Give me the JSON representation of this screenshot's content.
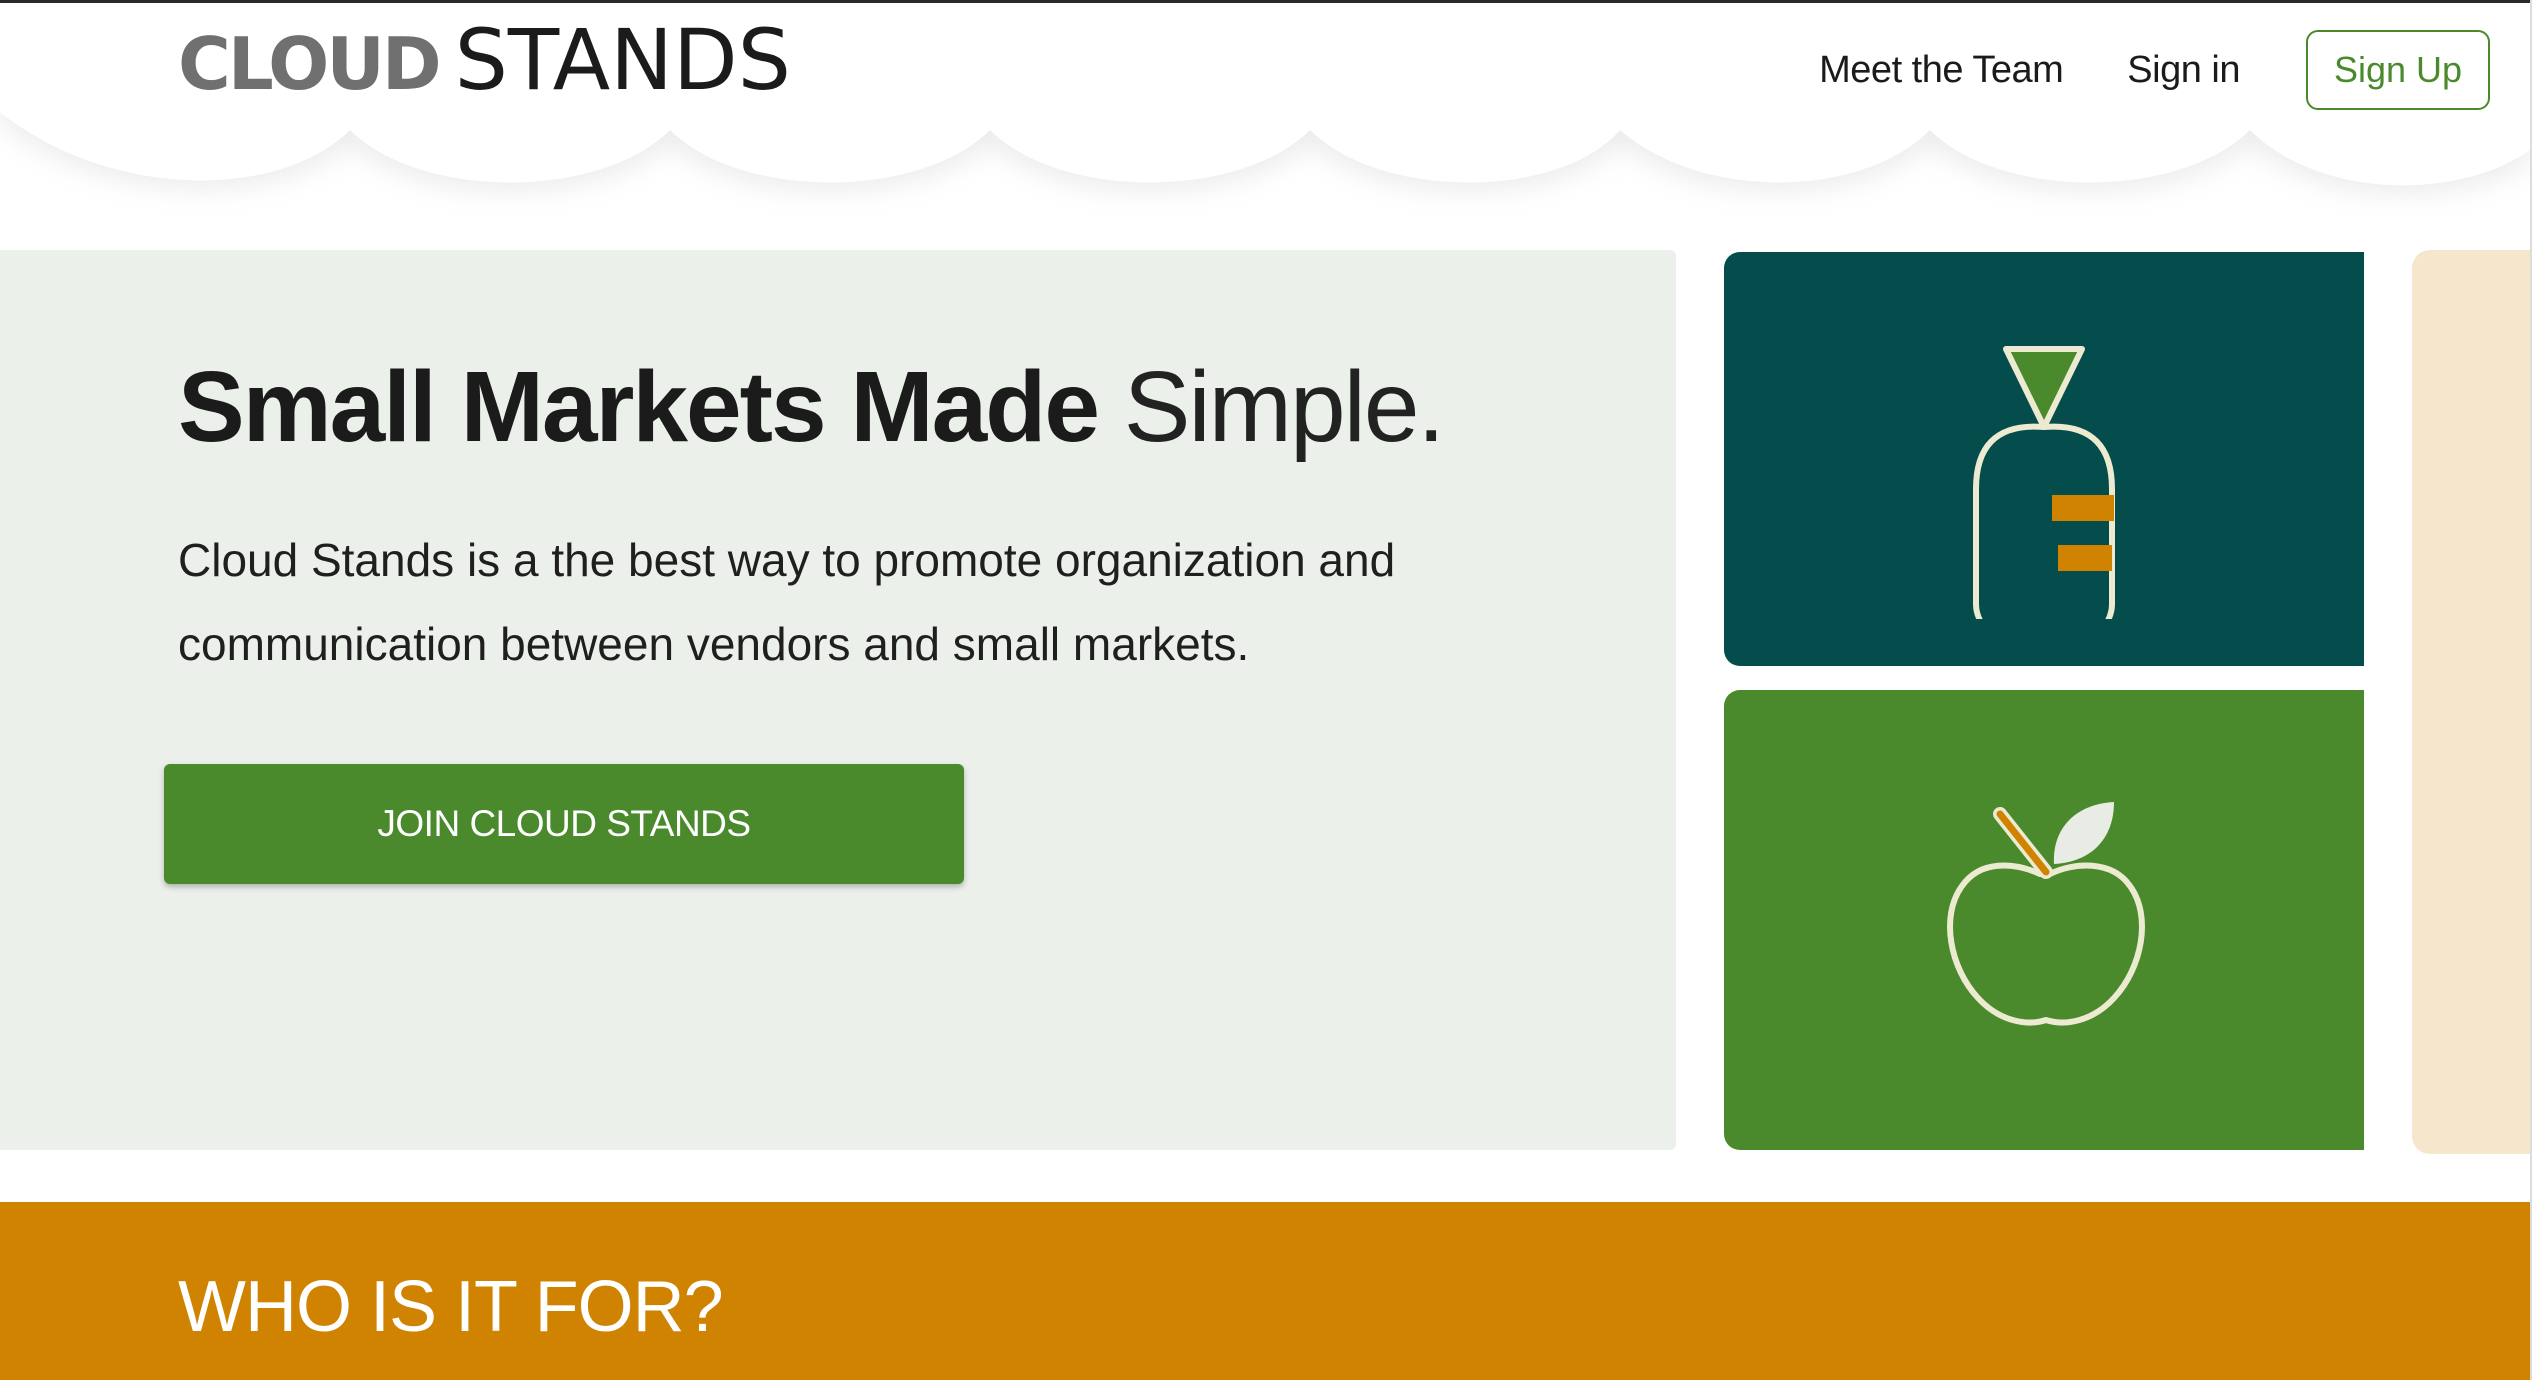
{
  "header": {
    "logo_bold": "CLOUD",
    "logo_thin": "STANDS",
    "nav": {
      "meet_team": "Meet the Team",
      "sign_in": "Sign in",
      "sign_up": "Sign Up"
    }
  },
  "hero": {
    "title_bold": "Small Markets Made",
    "title_light": "Simple.",
    "description": "Cloud Stands is a the best way to promote organization and communication between vendors and small markets.",
    "cta_label": "JOIN CLOUD STANDS"
  },
  "tiles": [
    {
      "icon": "carrot-icon",
      "color": "#054c4c"
    },
    {
      "icon": "apple-icon",
      "color": "#4a8a2c"
    },
    {
      "icon": "none",
      "color": "#f6e6cc"
    }
  ],
  "section": {
    "who_title": "WHO IS IT FOR?"
  },
  "colors": {
    "brand_green": "#4a8a2c",
    "teal": "#054c4c",
    "orange": "#cf8300",
    "hero_bg": "#ecf0ea",
    "peach": "#f6e6cc"
  }
}
